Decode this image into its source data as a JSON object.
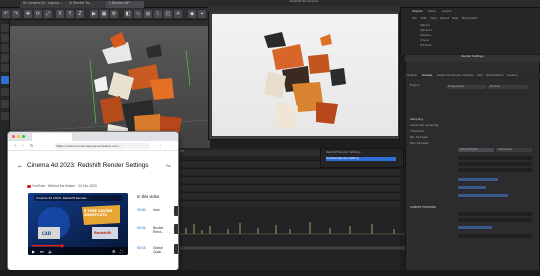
{
  "c4d": {
    "tabs": [
      "UI Camera 04 - Layout ...",
      "Ui Render Fo...",
      "2 Render v8*"
    ],
    "render_view_title": "Redshift RenderView",
    "render_settings_title": "Render Settings",
    "objmgr_tabs": [
      "Objects",
      "Takes",
      "Layers"
    ],
    "objmgr_menu": [
      "File",
      "Edit",
      "View",
      "Object",
      "Tags",
      "Bookmarks"
    ],
    "objects": [
      "Sphere",
      "Sphere.1",
      "Camera",
      "Cloner",
      "Fracture"
    ],
    "rs_tabs": [
      "Output",
      "Globals",
      "Global Illumination",
      "Caustics",
      "AOV",
      "Optimization",
      "System"
    ],
    "rs_rows": [
      "Engine",
      "Progressive",
      "Bucket"
    ],
    "rs_section": [
      "Sampling",
      "Automatic Sampling",
      "Threshold",
      "Min Samples",
      "Max Samples"
    ],
    "rs_dropdown_1": "Stone Bright",
    "rs_dropdown_2": "Automatic",
    "rs_section2": "SAMPLE FILTERING",
    "outline_items": [
      "Redshift Render Settings",
      "Untitled Render Setting"
    ],
    "frame_readout": "0 F",
    "frame_end": "90 F"
  },
  "browser": {
    "url": "https://maxonrender.wpenginepowered.com/...",
    "back_label": "←",
    "video_title": "Cinema 4d 2023: Redshift Render Settings",
    "channel_meta": "YouTube · Behind the Button · 24 Oct 2023",
    "thumb_title": "Cinema 4d 2023: Redshift Render...",
    "thumb_caption": "5 TIME SAVING SHORTCUTS",
    "c4d_logo": "C4D",
    "red_label": "Redshift",
    "in_this_video": "In this video",
    "side_label": "Pol",
    "chapters": [
      {
        "time": "00:00",
        "label": "Intro"
      },
      {
        "time": "00:04",
        "label": "Bucket Rend..."
      },
      {
        "time": "00:15",
        "label": "Global Quali..."
      }
    ]
  },
  "colors": {
    "accent": "#2f6fd6",
    "render_bg": "#eeeeee",
    "ui_dark": "#2c2c2e"
  }
}
